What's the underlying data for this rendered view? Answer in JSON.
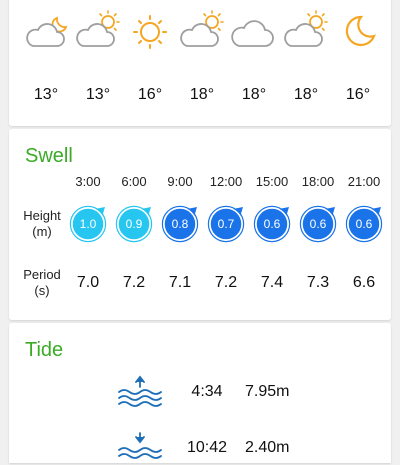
{
  "weather": {
    "items": [
      {
        "icon": "cloud-moon-icon",
        "temp": "13°"
      },
      {
        "icon": "cloud-sun-icon",
        "temp": "13°"
      },
      {
        "icon": "sun-icon",
        "temp": "16°"
      },
      {
        "icon": "cloud-sun-icon",
        "temp": "18°"
      },
      {
        "icon": "cloud-icon",
        "temp": "18°"
      },
      {
        "icon": "cloud-sun-icon",
        "temp": "18°"
      },
      {
        "icon": "moon-icon",
        "temp": "16°"
      }
    ]
  },
  "swell": {
    "title": "Swell",
    "height_label": [
      "Height",
      "(m)"
    ],
    "period_label": [
      "Period",
      "(s)"
    ],
    "times": [
      "3:00",
      "6:00",
      "9:00",
      "12:00",
      "15:00",
      "18:00",
      "21:00"
    ],
    "heights": [
      "1.0",
      "0.9",
      "0.8",
      "0.7",
      "0.6",
      "0.6",
      "0.6"
    ],
    "periods": [
      "7.0",
      "7.2",
      "7.1",
      "7.2",
      "7.4",
      "7.3",
      "6.6"
    ],
    "badge_colors": [
      "#26c6f0",
      "#26c6f0",
      "#1a73e8",
      "#1a73e8",
      "#1a73e8",
      "#1a73e8",
      "#1a73e8"
    ]
  },
  "tide": {
    "title": "Tide",
    "entries": [
      {
        "icon": "high-tide-icon",
        "time": "4:34",
        "height": "7.95m"
      },
      {
        "icon": "low-tide-icon",
        "time": "10:42",
        "height": "2.40m"
      }
    ]
  },
  "colors": {
    "accent_green": "#3bab26",
    "sun": "#f5a623",
    "cloud": "#9e9e9e",
    "tide_icon": "#1e6fb8"
  }
}
